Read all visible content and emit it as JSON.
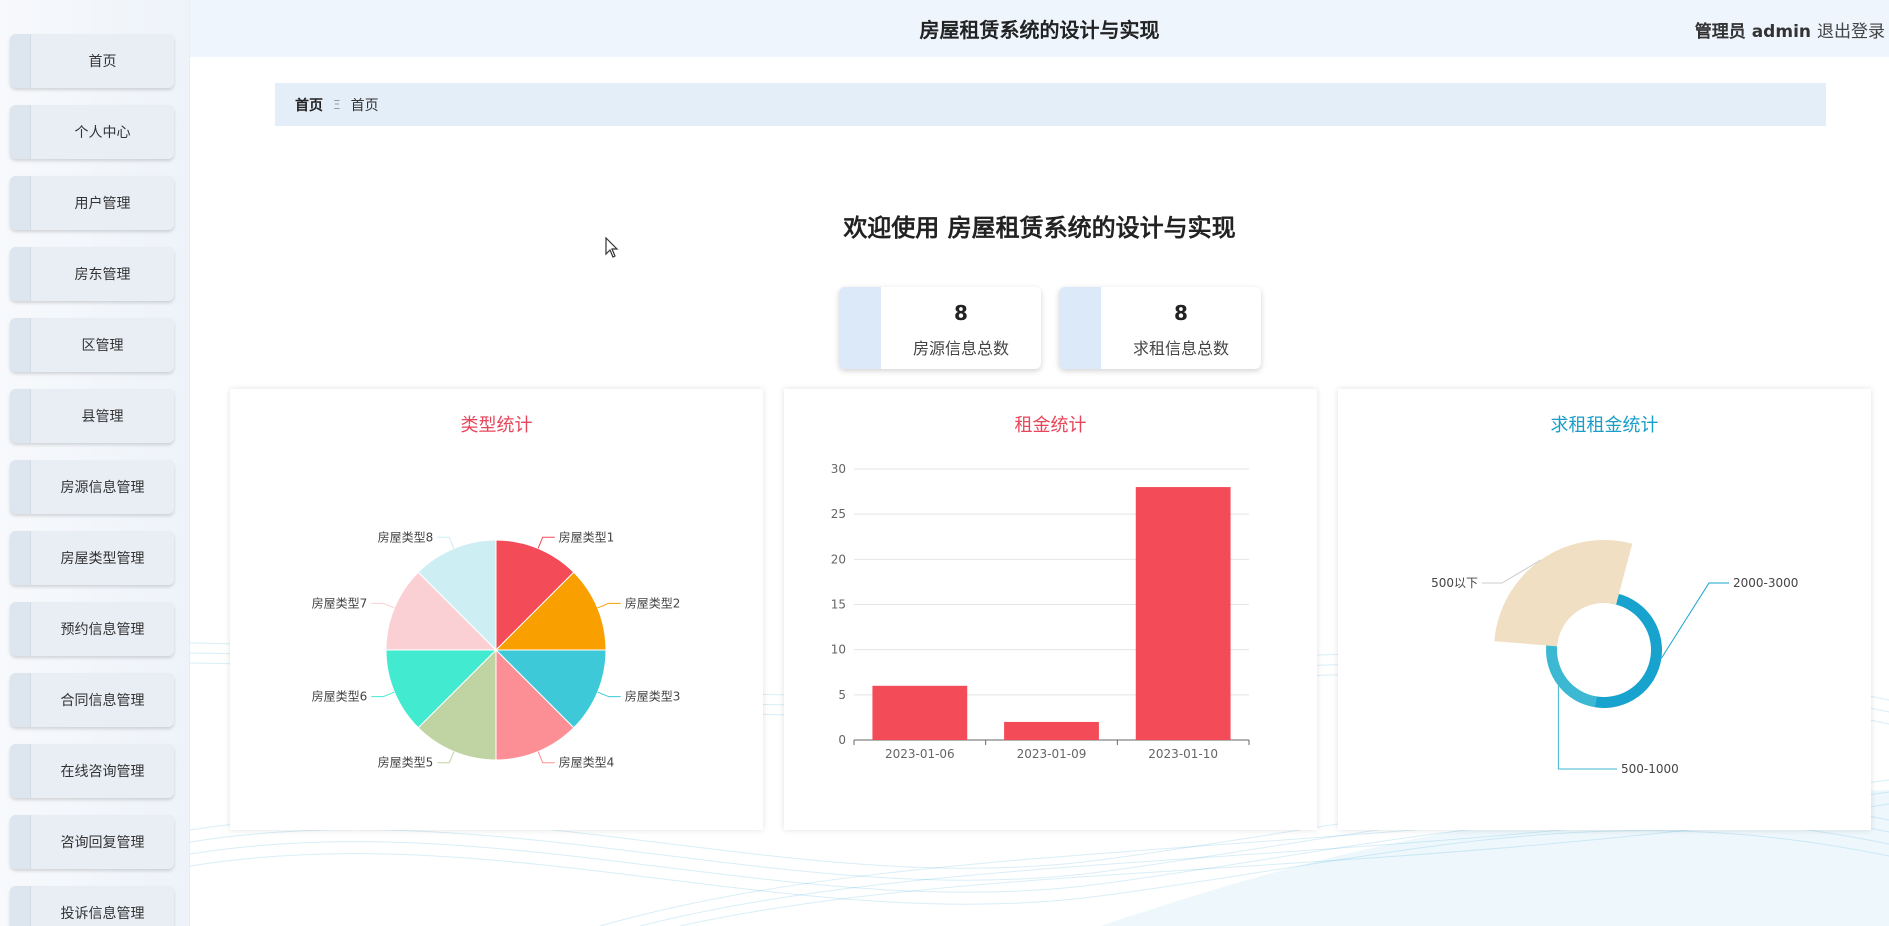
{
  "header": {
    "title": "房屋租赁系统的设计与实现",
    "user": "管理员 admin",
    "logout": "退出登录"
  },
  "sidebar": {
    "items": [
      {
        "label": "首页"
      },
      {
        "label": "个人中心"
      },
      {
        "label": "用户管理"
      },
      {
        "label": "房东管理"
      },
      {
        "label": "区管理"
      },
      {
        "label": "县管理"
      },
      {
        "label": "房源信息管理"
      },
      {
        "label": "房屋类型管理"
      },
      {
        "label": "预约信息管理"
      },
      {
        "label": "合同信息管理"
      },
      {
        "label": "在线咨询管理"
      },
      {
        "label": "咨询回复管理"
      },
      {
        "label": "投诉信息管理"
      }
    ]
  },
  "breadcrumb": {
    "home": "首页",
    "separator": "Ξ",
    "current": "首页"
  },
  "welcome": "欢迎使用 房屋租赁系统的设计与实现",
  "stats": [
    {
      "value": "8",
      "label": "房源信息总数"
    },
    {
      "value": "8",
      "label": "求租信息总数"
    }
  ],
  "colors": {
    "accent_red": "#e8455a",
    "accent_teal": "#1a9ec9"
  },
  "panels": {
    "type_title": "类型统计",
    "rent_title": "租金统计",
    "seek_title": "求租租金统计"
  },
  "chart_data": [
    {
      "type": "pie",
      "title": "类型统计",
      "categories": [
        "房屋类型1",
        "房屋类型2",
        "房屋类型3",
        "房屋类型4",
        "房屋类型5",
        "房屋类型6",
        "房屋类型7",
        "房屋类型8"
      ],
      "values": [
        1,
        1,
        1,
        1,
        1,
        1,
        1,
        1
      ],
      "colors": [
        "#f44b58",
        "#fa9f00",
        "#3ec9d9",
        "#fb8f95",
        "#c0d3a3",
        "#42ead0",
        "#fbd0d4",
        "#cdeff4"
      ]
    },
    {
      "type": "bar",
      "title": "租金统计",
      "categories": [
        "2023-01-06",
        "2023-01-09",
        "2023-01-10"
      ],
      "values": [
        6,
        2,
        28
      ],
      "ylim": [
        0,
        30
      ],
      "yticks": [
        0,
        5,
        10,
        15,
        20,
        25,
        30
      ],
      "grid": true,
      "color": "#f44b58"
    },
    {
      "type": "pie",
      "title": "求租租金统计",
      "categories": [
        "2000-3000",
        "500-1000",
        "500以下"
      ],
      "values": [
        1,
        1,
        1
      ],
      "colors": [
        "#17a3cd",
        "#3cb8d2",
        "#f0dfc2"
      ]
    }
  ]
}
